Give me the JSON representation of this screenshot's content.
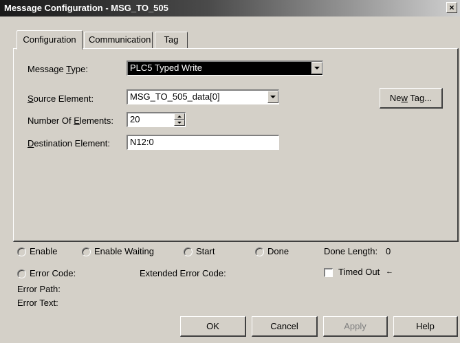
{
  "window": {
    "title": "Message Configuration - MSG_TO_505",
    "close_glyph": "×"
  },
  "tabs": [
    {
      "label": "Configuration",
      "active": true
    },
    {
      "label": "Communication",
      "active": false
    },
    {
      "label": "Tag",
      "active": false
    }
  ],
  "config": {
    "message_type": {
      "label_pre": "Message ",
      "label_ul": "T",
      "label_post": "ype:",
      "value": "PLC5 Typed Write"
    },
    "source_element": {
      "label_pre": "",
      "label_ul": "S",
      "label_post": "ource Element:",
      "value": "MSG_TO_505_data[0]"
    },
    "num_elements": {
      "label_pre": "Number Of ",
      "label_ul": "E",
      "label_post": "lements:",
      "value": "20"
    },
    "destination_element": {
      "label_pre": "",
      "label_ul": "D",
      "label_post": "estination Element:",
      "value": "N12:0"
    },
    "new_tag_button": {
      "pre": "Ne",
      "ul": "w",
      "post": " Tag..."
    }
  },
  "status": {
    "enable": "Enable",
    "enable_waiting": "Enable Waiting",
    "start": "Start",
    "done": "Done",
    "done_length_label": "Done Length:",
    "done_length_value": "0",
    "error_code": "Error Code:",
    "extended_error_code": "Extended Error Code:",
    "timed_out": "Timed Out",
    "timed_out_arrow": "←",
    "error_path": "Error Path:",
    "error_text": "Error Text:"
  },
  "buttons": {
    "ok": "OK",
    "cancel": "Cancel",
    "apply": "Apply",
    "help": "Help"
  }
}
